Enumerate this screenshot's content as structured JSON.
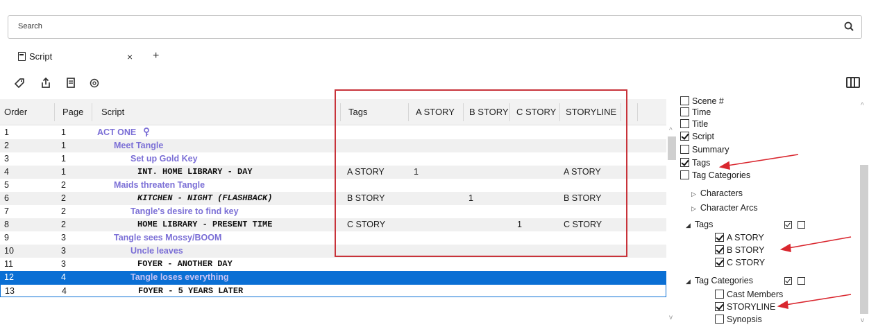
{
  "search": {
    "placeholder": "Search",
    "icon": "search-icon"
  },
  "tabs": [
    {
      "label": "Script",
      "icon": "document-icon",
      "close": "×"
    }
  ],
  "tab_add": "+",
  "toolbar": {
    "icons": [
      "tag-icon",
      "export-icon",
      "document-icon",
      "settings-circle-icon"
    ],
    "right_icon": "columns-icon"
  },
  "grid": {
    "columns": [
      "Order",
      "Page",
      "Script",
      "Tags",
      "A STORY",
      "B STORY",
      "C STORY",
      "STORYLINE"
    ],
    "rows": [
      {
        "order": "1",
        "page": "1",
        "script": "ACT ONE",
        "style": "pur",
        "indent": 0,
        "tags": "",
        "a": "",
        "b": "",
        "c": "",
        "storyline": "",
        "key_icon": true
      },
      {
        "order": "2",
        "page": "1",
        "script": "Meet Tangle",
        "style": "pur",
        "indent": 1,
        "tags": "",
        "a": "",
        "b": "",
        "c": "",
        "storyline": ""
      },
      {
        "order": "3",
        "page": "1",
        "script": "Set up Gold Key",
        "style": "pur",
        "indent": 2,
        "tags": "",
        "a": "",
        "b": "",
        "c": "",
        "storyline": ""
      },
      {
        "order": "4",
        "page": "1",
        "script": "INT. HOME LIBRARY - DAY",
        "style": "mono",
        "indent": 3,
        "tags": "A STORY",
        "a": "1",
        "b": "",
        "c": "",
        "storyline": "A STORY"
      },
      {
        "order": "5",
        "page": "2",
        "script": "Maids threaten Tangle",
        "style": "pur",
        "indent": 1,
        "tags": "",
        "a": "",
        "b": "",
        "c": "",
        "storyline": ""
      },
      {
        "order": "6",
        "page": "2",
        "script": "KITCHEN - NIGHT (FLASHBACK)",
        "style": "mono-it",
        "indent": 3,
        "tags": "B STORY",
        "a": "",
        "b": "1",
        "c": "",
        "storyline": "B STORY"
      },
      {
        "order": "7",
        "page": "2",
        "script": "Tangle's desire to find key",
        "style": "pur",
        "indent": 2,
        "tags": "",
        "a": "",
        "b": "",
        "c": "",
        "storyline": ""
      },
      {
        "order": "8",
        "page": "2",
        "script": "HOME LIBRARY - PRESENT TIME",
        "style": "mono",
        "indent": 3,
        "tags": "C STORY",
        "a": "",
        "b": "",
        "c": "1",
        "storyline": "C STORY"
      },
      {
        "order": "9",
        "page": "3",
        "script": "Tangle sees Mossy/BOOM",
        "style": "pur",
        "indent": 1,
        "tags": "",
        "a": "",
        "b": "",
        "c": "",
        "storyline": ""
      },
      {
        "order": "10",
        "page": "3",
        "script": "Uncle leaves",
        "style": "pur",
        "indent": 2,
        "tags": "",
        "a": "",
        "b": "",
        "c": "",
        "storyline": ""
      },
      {
        "order": "11",
        "page": "3",
        "script": "FOYER - ANOTHER DAY",
        "style": "mono",
        "indent": 3,
        "tags": "",
        "a": "",
        "b": "",
        "c": "",
        "storyline": ""
      },
      {
        "order": "12",
        "page": "4",
        "script": "Tangle loses everything",
        "style": "pur",
        "indent": 2,
        "tags": "",
        "a": "",
        "b": "",
        "c": "",
        "storyline": ""
      },
      {
        "order": "13",
        "page": "4",
        "script": "FOYER - 5 YEARS LATER",
        "style": "mono",
        "indent": 3,
        "tags": "",
        "a": "",
        "b": "",
        "c": "",
        "storyline": ""
      }
    ]
  },
  "panel": {
    "items": [
      {
        "label": "Scene #",
        "checked": false,
        "level": 0
      },
      {
        "label": "Time",
        "checked": false,
        "level": 0
      },
      {
        "label": "Title",
        "checked": false,
        "level": 0
      },
      {
        "label": "Script",
        "checked": true,
        "level": 0
      },
      {
        "label": "Summary",
        "checked": false,
        "level": 0
      },
      {
        "label": "Tags",
        "checked": true,
        "level": 0
      },
      {
        "label": "Tag Categories",
        "checked": false,
        "level": 0
      }
    ],
    "tree_characters": "Characters",
    "tree_character_arcs": "Character Arcs",
    "tree_tags": "Tags",
    "tag_items": [
      {
        "label": "A STORY",
        "checked": true
      },
      {
        "label": "B STORY",
        "checked": true
      },
      {
        "label": "C STORY",
        "checked": true
      }
    ],
    "tree_tag_categories": "Tag Categories",
    "category_items": [
      {
        "label": "Cast Members",
        "checked": false
      },
      {
        "label": "STORYLINE",
        "checked": true
      },
      {
        "label": "Synopsis",
        "checked": false
      }
    ]
  },
  "colors": {
    "selection": "#0a6fd4",
    "outline_text": "#7b6fd6",
    "highlight_box": "#c8333a",
    "annotation_arrow": "#d9262e"
  }
}
